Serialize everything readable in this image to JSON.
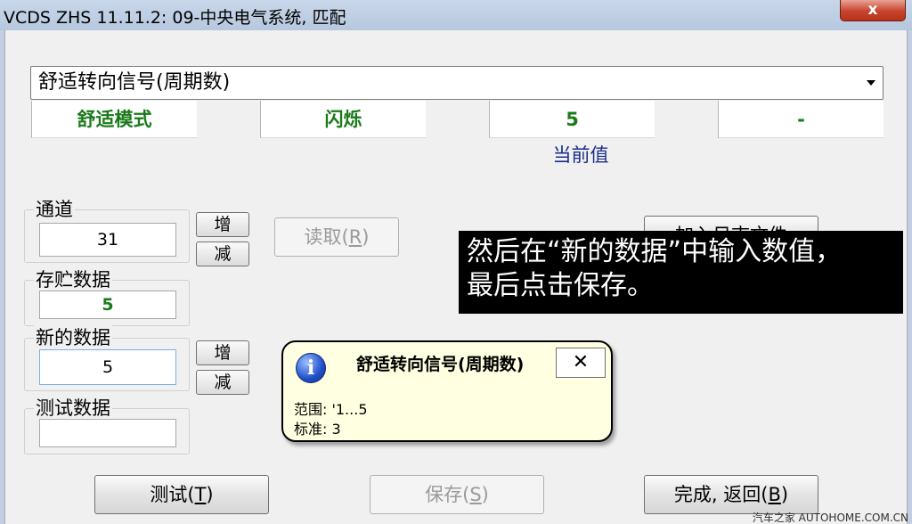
{
  "window": {
    "title": "VCDS ZHS 11.11.2: 09-中央电气系统,  匹配",
    "close_label": "x"
  },
  "channel_select": {
    "value": "舒适转向信号(周期数)"
  },
  "value_cells": [
    "舒适模式",
    "闪烁",
    "5",
    "-"
  ],
  "current_value_label": "当前值",
  "channel_group": {
    "label": "通道",
    "value": "31",
    "increase_label": "增",
    "decrease_label": "减"
  },
  "read_button": {
    "label": "读取(",
    "key": "R",
    "suffix": ")"
  },
  "log_button": {
    "label": "加入日志文件"
  },
  "stored_group": {
    "label": "存贮数据",
    "value": "5"
  },
  "new_group": {
    "label": "新的数据",
    "value": "5",
    "increase_label": "增",
    "decrease_label": "减"
  },
  "test_group": {
    "label": "测试数据",
    "value": ""
  },
  "overlay": {
    "line1": "然后在“新的数据”中输入数值，",
    "line2": "最后点击保存。"
  },
  "tooltip": {
    "icon": "info-icon",
    "title": "舒适转向信号(周期数)",
    "close_label": "✕",
    "range_line": "范围: '1...5",
    "standard_line": "标准: 3"
  },
  "bottom_buttons": {
    "test": {
      "label": "测试(",
      "key": "T",
      "suffix": ")"
    },
    "save": {
      "label": "保存(",
      "key": "S",
      "suffix": ")"
    },
    "done": {
      "label": "完成, 返回(",
      "key": "B",
      "suffix": ")"
    }
  },
  "watermark": "汽车之家  AUTOHOME.COM.CN",
  "colors": {
    "value_green": "#1a7a1a",
    "label_blue": "#1a2d8a",
    "close_red": "#c7432c",
    "tooltip_bg": "#ffffe1"
  }
}
